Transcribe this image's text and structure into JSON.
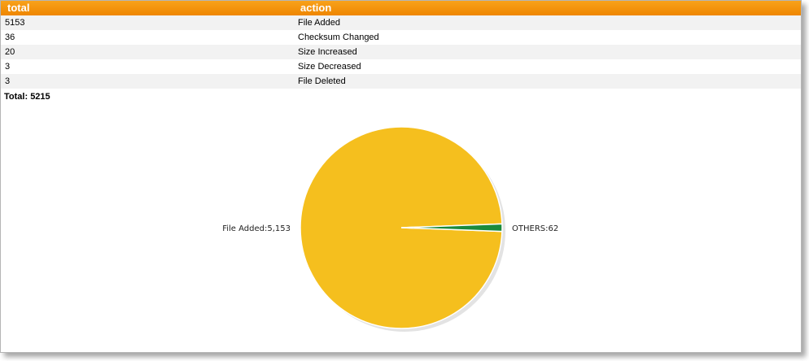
{
  "table": {
    "headers": {
      "total": "total",
      "action": "action"
    },
    "rows": [
      {
        "total": "5153",
        "action": "File Added"
      },
      {
        "total": "36",
        "action": "Checksum Changed"
      },
      {
        "total": "20",
        "action": "Size Increased"
      },
      {
        "total": "3",
        "action": "Size Decreased"
      },
      {
        "total": "3",
        "action": "File Deleted"
      }
    ],
    "grand_total_label": "Total:",
    "grand_total_value": "5215"
  },
  "chart_data": {
    "type": "pie",
    "slices": [
      {
        "label": "File Added",
        "value": 5153,
        "display": "File Added:5,153",
        "color": "#f5bf1e"
      },
      {
        "label": "OTHERS",
        "value": 62,
        "display": "OTHERS:62",
        "color": "#1a8a3c"
      }
    ]
  }
}
